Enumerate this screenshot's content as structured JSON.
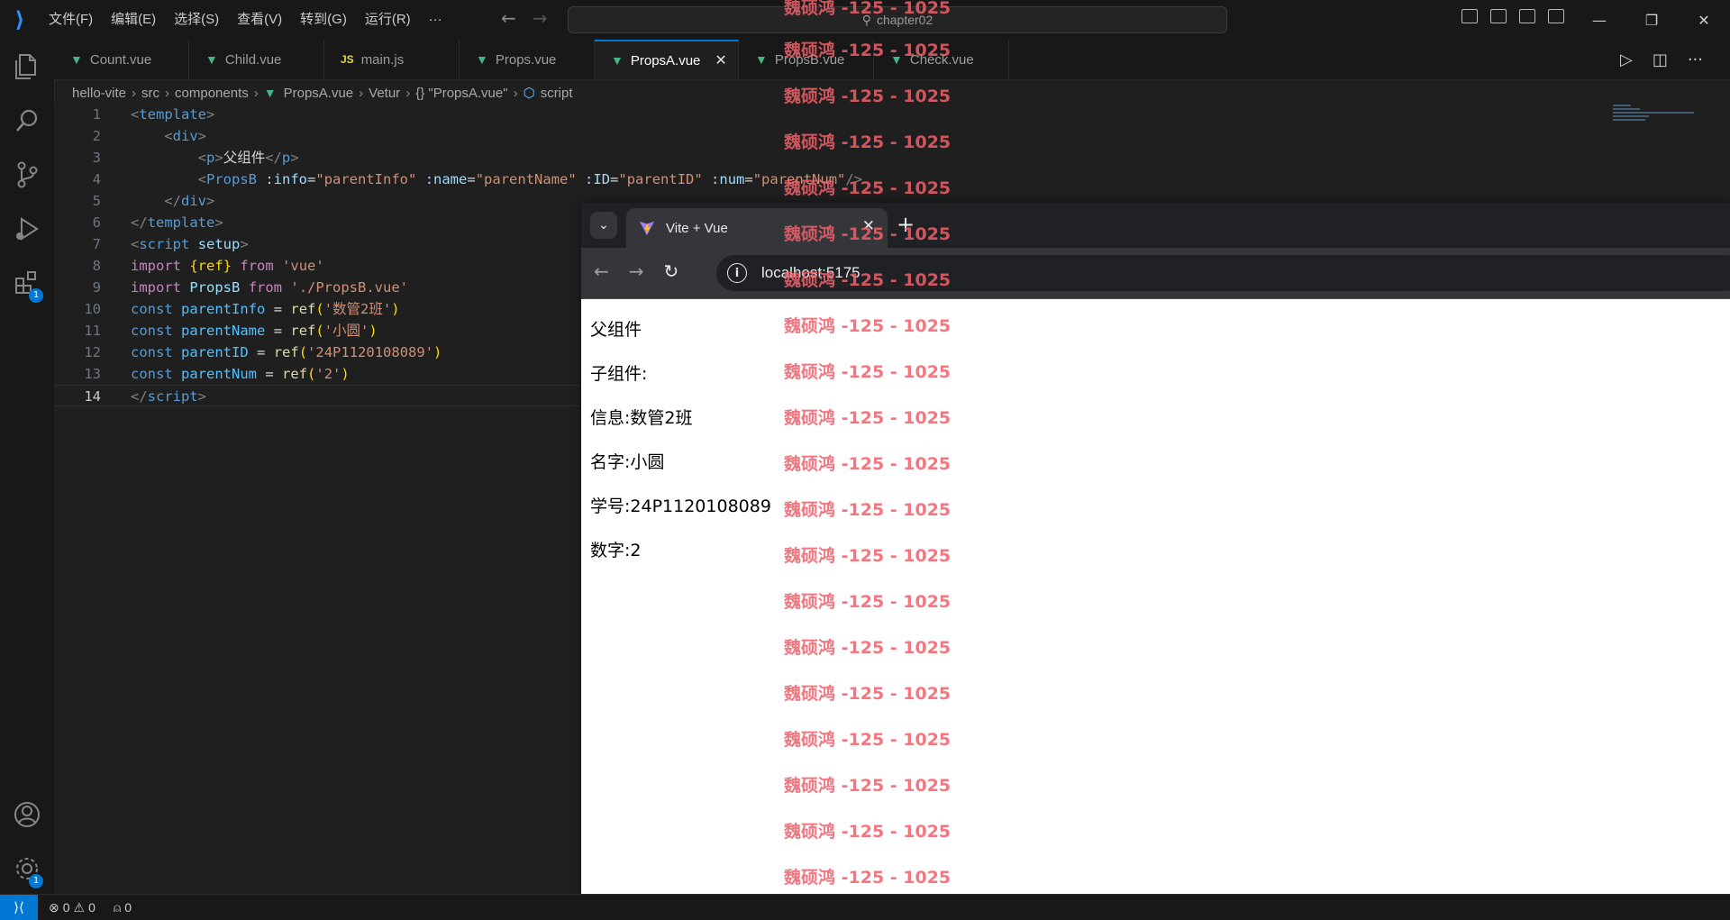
{
  "window": {
    "menu": [
      "文件(F)",
      "编辑(E)",
      "选择(S)",
      "查看(V)",
      "转到(G)",
      "运行(R)",
      "···"
    ],
    "search": "chapter02"
  },
  "activity_bar": {
    "extensions_badge": "1",
    "settings_badge": "1"
  },
  "tabs": [
    {
      "label": "Count.vue",
      "icon": "vue-icon"
    },
    {
      "label": "Child.vue",
      "icon": "vue-icon"
    },
    {
      "label": "main.js",
      "icon": "js-icon"
    },
    {
      "label": "Props.vue",
      "icon": "vue-icon"
    },
    {
      "label": "PropsA.vue",
      "icon": "vue-icon",
      "active": true
    },
    {
      "label": "PropsB.vue",
      "icon": "vue-icon"
    },
    {
      "label": "Check.vue",
      "icon": "vue-icon"
    }
  ],
  "breadcrumb": [
    "hello-vite",
    "src",
    "components",
    "PropsA.vue",
    "Vetur",
    "{} \"PropsA.vue\"",
    "script"
  ],
  "code": {
    "line_numbers": [
      "1",
      "2",
      "3",
      "4",
      "5",
      "6",
      "7",
      "8",
      "9",
      "10",
      "11",
      "12",
      "13",
      "14"
    ],
    "current_line": "14",
    "tokens": {
      "template": "template",
      "div": "div",
      "p": "p",
      "p_text": "父组件",
      "propsb": "PropsB",
      "attr_info": ":info",
      "attr_name": ":name",
      "attr_id": ":ID",
      "attr_num": ":num",
      "v_info": "\"parentInfo\"",
      "v_name": "\"parentName\"",
      "v_id": "\"parentID\"",
      "v_num": "\"parentNum\"",
      "script": "script",
      "setup": "setup",
      "import": "import",
      "from": "from",
      "const": "const",
      "ref": "ref",
      "ref_brace": "{ref}",
      "str_vue": "'vue'",
      "propsb_id": "PropsB",
      "str_path": "'./PropsB.vue'",
      "parentInfo": "parentInfo",
      "parentName": "parentName",
      "parentID": "parentID",
      "parentNum": "parentNum",
      "eq": "=",
      "s_info": "'数管2班'",
      "s_name": "'小圆'",
      "s_id": "'24P1120108089'",
      "s_num": "'2'"
    }
  },
  "browser": {
    "tab_title": "Vite + Vue",
    "url": "localhost:5175",
    "content": [
      "父组件",
      "子组件:",
      "信息:数管2班",
      "名字:小圆",
      "学号:24P1120108089",
      "数字:2"
    ]
  },
  "watermark": "魏硕鸿 -125 - 1025",
  "status_bar": {
    "errors": "0",
    "warnings": "0",
    "ports": "0"
  }
}
